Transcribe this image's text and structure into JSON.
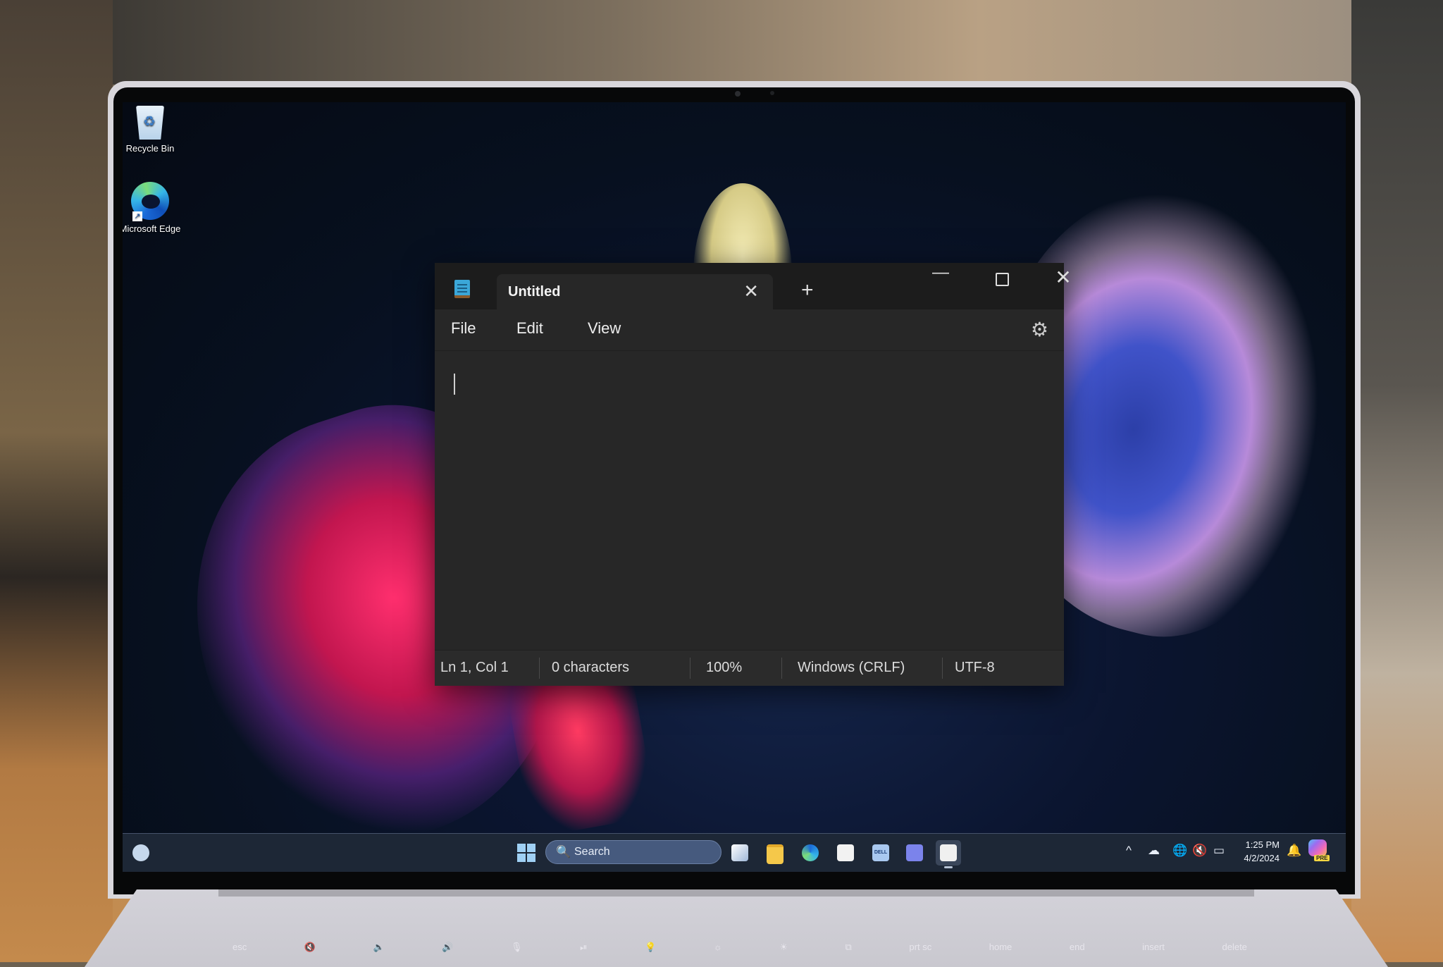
{
  "desktop": {
    "icons": [
      {
        "label": "Recycle Bin",
        "icon": "recycle-bin-icon"
      },
      {
        "label": "Microsoft Edge",
        "icon": "edge-icon"
      }
    ]
  },
  "notepad": {
    "tab_title": "Untitled",
    "new_tab": "+",
    "close_tab": "✕",
    "window_controls": {
      "minimize": "—",
      "close": "✕"
    },
    "menu": [
      "File",
      "Edit",
      "View"
    ],
    "settings_icon": "⚙",
    "content": "",
    "status": {
      "position": "Ln 1, Col 1",
      "characters": "0 characters",
      "zoom": "100%",
      "line_ending": "Windows (CRLF)",
      "encoding": "UTF-8"
    }
  },
  "taskbar": {
    "search_placeholder": "Search",
    "search_icon": "🔍",
    "pinned_apps": [
      "Task View",
      "File Explorer",
      "Microsoft Edge",
      "Microsoft Store",
      "Dell",
      "Microsoft Teams",
      "Notepad"
    ],
    "active_app": "Notepad",
    "tray": {
      "chevron": "^",
      "cloud": "☁",
      "network": "🌐",
      "volume": "🔇",
      "battery": "▭",
      "bell": "🔔"
    },
    "time": "1:25 PM",
    "date": "4/2/2024",
    "copilot_badge": "PRE"
  },
  "keyboard": {
    "function_row": [
      "esc",
      "🔇",
      "🔈",
      "🔊",
      "🎙",
      "⏯",
      "💡",
      "☼",
      "☀",
      "⧉",
      "prt sc",
      "home",
      "end",
      "insert",
      "delete"
    ]
  }
}
